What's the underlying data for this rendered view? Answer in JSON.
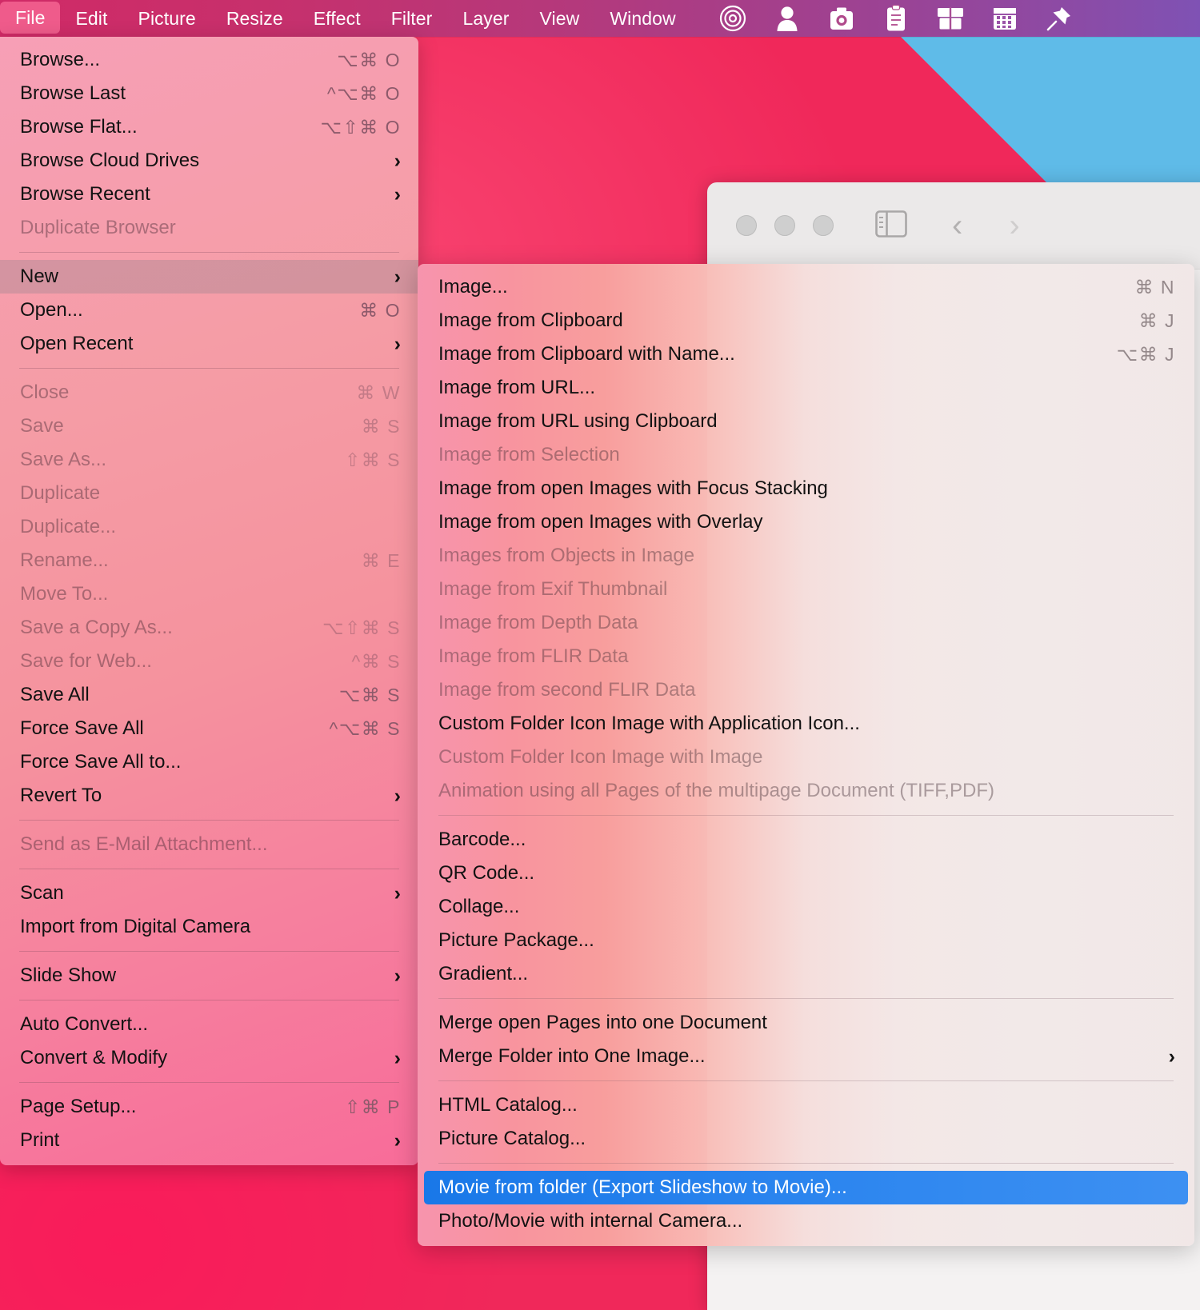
{
  "desktop": {
    "background_color": "#f0285a",
    "accent_wedge_color": "#5fbbe8"
  },
  "menubar": {
    "background_gradient_start": "#d02a66",
    "background_gradient_end": "#7f52b4",
    "active_item_color": "#ef5b8b",
    "items": [
      {
        "label": "File",
        "active": true
      },
      {
        "label": "Edit",
        "active": false
      },
      {
        "label": "Picture",
        "active": false
      },
      {
        "label": "Resize",
        "active": false
      },
      {
        "label": "Effect",
        "active": false
      },
      {
        "label": "Filter",
        "active": false
      },
      {
        "label": "Layer",
        "active": false
      },
      {
        "label": "View",
        "active": false
      },
      {
        "label": "Window",
        "active": false
      }
    ],
    "icons": [
      {
        "name": "target-icon"
      },
      {
        "name": "person-icon"
      },
      {
        "name": "camera-icon"
      },
      {
        "name": "clipboard-icon"
      },
      {
        "name": "archive-box-icon"
      },
      {
        "name": "calendar-icon"
      },
      {
        "name": "pin-icon"
      }
    ]
  },
  "background_window": {
    "traffic_lights": [
      "close",
      "minimize",
      "zoom"
    ],
    "toolbar_icons": [
      {
        "name": "sidebar-toggle-icon"
      },
      {
        "name": "back-chevron-icon",
        "glyph": "‹"
      },
      {
        "name": "forward-chevron-icon",
        "glyph": "›"
      }
    ]
  },
  "file_menu": {
    "title": "File",
    "groups": [
      {
        "items": [
          {
            "label": "Browse...",
            "shortcut": "⌥⌘ O",
            "disabled": false,
            "submenu": false
          },
          {
            "label": "Browse Last",
            "shortcut": "^⌥⌘ O",
            "disabled": false,
            "submenu": false
          },
          {
            "label": "Browse Flat...",
            "shortcut": "⌥⇧⌘ O",
            "disabled": false,
            "submenu": false
          },
          {
            "label": "Browse Cloud Drives",
            "shortcut": "",
            "disabled": false,
            "submenu": true
          },
          {
            "label": "Browse Recent",
            "shortcut": "",
            "disabled": false,
            "submenu": true
          },
          {
            "label": "Duplicate Browser",
            "shortcut": "",
            "disabled": true,
            "submenu": false
          }
        ]
      },
      {
        "items": [
          {
            "label": "New",
            "shortcut": "",
            "disabled": false,
            "submenu": true,
            "highlighted": true
          },
          {
            "label": "Open...",
            "shortcut": "⌘ O",
            "disabled": false,
            "submenu": false
          },
          {
            "label": "Open Recent",
            "shortcut": "",
            "disabled": false,
            "submenu": true
          }
        ]
      },
      {
        "items": [
          {
            "label": "Close",
            "shortcut": "⌘ W",
            "disabled": true,
            "submenu": false
          },
          {
            "label": "Save",
            "shortcut": "⌘ S",
            "disabled": true,
            "submenu": false
          },
          {
            "label": "Save As...",
            "shortcut": "⇧⌘ S",
            "disabled": true,
            "submenu": false
          },
          {
            "label": "Duplicate",
            "shortcut": "",
            "disabled": true,
            "submenu": false
          },
          {
            "label": "Duplicate...",
            "shortcut": "",
            "disabled": true,
            "submenu": false
          },
          {
            "label": "Rename...",
            "shortcut": "⌘ E",
            "disabled": true,
            "submenu": false
          },
          {
            "label": "Move To...",
            "shortcut": "",
            "disabled": true,
            "submenu": false
          },
          {
            "label": "Save a Copy As...",
            "shortcut": "⌥⇧⌘ S",
            "disabled": true,
            "submenu": false
          },
          {
            "label": "Save for Web...",
            "shortcut": "^⌘ S",
            "disabled": true,
            "submenu": false
          },
          {
            "label": "Save All",
            "shortcut": "⌥⌘ S",
            "disabled": false,
            "submenu": false
          },
          {
            "label": "Force Save All",
            "shortcut": "^⌥⌘ S",
            "disabled": false,
            "submenu": false
          },
          {
            "label": "Force Save All to...",
            "shortcut": "",
            "disabled": false,
            "submenu": false
          },
          {
            "label": "Revert To",
            "shortcut": "",
            "disabled": false,
            "submenu": true
          }
        ]
      },
      {
        "items": [
          {
            "label": "Send as E-Mail Attachment...",
            "shortcut": "",
            "disabled": true,
            "submenu": false
          }
        ]
      },
      {
        "items": [
          {
            "label": "Scan",
            "shortcut": "",
            "disabled": false,
            "submenu": true
          },
          {
            "label": "Import from Digital Camera",
            "shortcut": "",
            "disabled": false,
            "submenu": false
          }
        ]
      },
      {
        "items": [
          {
            "label": "Slide Show",
            "shortcut": "",
            "disabled": false,
            "submenu": true
          }
        ]
      },
      {
        "items": [
          {
            "label": "Auto Convert...",
            "shortcut": "",
            "disabled": false,
            "submenu": false
          },
          {
            "label": "Convert & Modify",
            "shortcut": "",
            "disabled": false,
            "submenu": true
          }
        ]
      },
      {
        "items": [
          {
            "label": "Page Setup...",
            "shortcut": "⇧⌘ P",
            "disabled": false,
            "submenu": false
          },
          {
            "label": "Print",
            "shortcut": "",
            "disabled": false,
            "submenu": true
          }
        ]
      }
    ]
  },
  "new_submenu": {
    "parent_item": "New",
    "selected_item": "Movie from folder (Export Slideshow to Movie)...",
    "selection_color": "#2d86ef",
    "groups": [
      {
        "items": [
          {
            "label": "Image...",
            "shortcut": "⌘ N",
            "disabled": false,
            "submenu": false
          },
          {
            "label": "Image from Clipboard",
            "shortcut": "⌘ J",
            "disabled": false,
            "submenu": false
          },
          {
            "label": "Image from Clipboard with Name...",
            "shortcut": "⌥⌘ J",
            "disabled": false,
            "submenu": false
          },
          {
            "label": "Image from URL...",
            "shortcut": "",
            "disabled": false,
            "submenu": false
          },
          {
            "label": "Image from URL using Clipboard",
            "shortcut": "",
            "disabled": false,
            "submenu": false
          },
          {
            "label": "Image from Selection",
            "shortcut": "",
            "disabled": true,
            "submenu": false
          },
          {
            "label": "Image from open Images with Focus Stacking",
            "shortcut": "",
            "disabled": false,
            "submenu": false
          },
          {
            "label": "Image from open Images with Overlay",
            "shortcut": "",
            "disabled": false,
            "submenu": false
          },
          {
            "label": "Images from Objects in Image",
            "shortcut": "",
            "disabled": true,
            "submenu": false
          },
          {
            "label": "Image from Exif Thumbnail",
            "shortcut": "",
            "disabled": true,
            "submenu": false
          },
          {
            "label": "Image from Depth Data",
            "shortcut": "",
            "disabled": true,
            "submenu": false
          },
          {
            "label": "Image from FLIR Data",
            "shortcut": "",
            "disabled": true,
            "submenu": false
          },
          {
            "label": "Image from second FLIR Data",
            "shortcut": "",
            "disabled": true,
            "submenu": false
          },
          {
            "label": "Custom Folder Icon Image with Application Icon...",
            "shortcut": "",
            "disabled": false,
            "submenu": false
          },
          {
            "label": "Custom Folder Icon Image with Image",
            "shortcut": "",
            "disabled": true,
            "submenu": false
          },
          {
            "label": "Animation using all Pages of the multipage Document (TIFF,PDF)",
            "shortcut": "",
            "disabled": true,
            "submenu": false
          }
        ]
      },
      {
        "items": [
          {
            "label": "Barcode...",
            "shortcut": "",
            "disabled": false,
            "submenu": false
          },
          {
            "label": "QR Code...",
            "shortcut": "",
            "disabled": false,
            "submenu": false
          },
          {
            "label": "Collage...",
            "shortcut": "",
            "disabled": false,
            "submenu": false
          },
          {
            "label": "Picture Package...",
            "shortcut": "",
            "disabled": false,
            "submenu": false
          },
          {
            "label": "Gradient...",
            "shortcut": "",
            "disabled": false,
            "submenu": false
          }
        ]
      },
      {
        "items": [
          {
            "label": "Merge open Pages into one Document",
            "shortcut": "",
            "disabled": false,
            "submenu": false
          },
          {
            "label": "Merge Folder into One Image...",
            "shortcut": "",
            "disabled": false,
            "submenu": true
          }
        ]
      },
      {
        "items": [
          {
            "label": "HTML Catalog...",
            "shortcut": "",
            "disabled": false,
            "submenu": false
          },
          {
            "label": "Picture Catalog...",
            "shortcut": "",
            "disabled": false,
            "submenu": false
          }
        ]
      },
      {
        "items": [
          {
            "label": "Movie from folder (Export Slideshow to Movie)...",
            "shortcut": "",
            "disabled": false,
            "submenu": false,
            "selected": true
          },
          {
            "label": "Photo/Movie with internal Camera...",
            "shortcut": "",
            "disabled": false,
            "submenu": false
          }
        ]
      }
    ]
  }
}
